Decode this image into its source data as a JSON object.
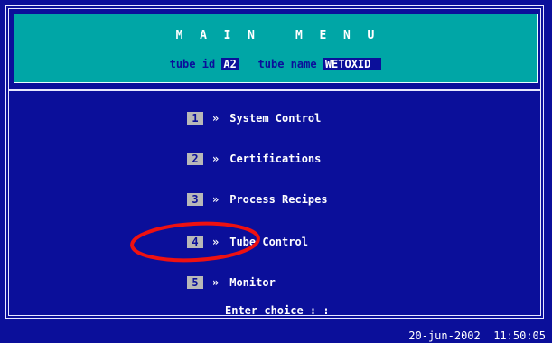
{
  "header": {
    "title": "M  A  I  N     M  E  N  U",
    "tube_id_label": "tube id",
    "tube_id_value": "A2",
    "tube_name_label": "tube name",
    "tube_name_value": "WETOXID"
  },
  "menu": {
    "items": [
      {
        "key": "1",
        "arrow": "»",
        "label": "System Control"
      },
      {
        "key": "2",
        "arrow": "»",
        "label": "Certifications"
      },
      {
        "key": "3",
        "arrow": "»",
        "label": "Process Recipes"
      },
      {
        "key": "4",
        "arrow": "»",
        "label": "Tube Control"
      },
      {
        "key": "5",
        "arrow": "»",
        "label": "Monitor"
      }
    ],
    "prompt": "Enter choice : :"
  },
  "status": {
    "date": "20-jun-2002",
    "time": "11:50:05"
  },
  "colors": {
    "background": "#0b0f9a",
    "header": "#00a6a6",
    "key_box": "#b8b8b8",
    "highlight_annotation": "#ee1111"
  }
}
